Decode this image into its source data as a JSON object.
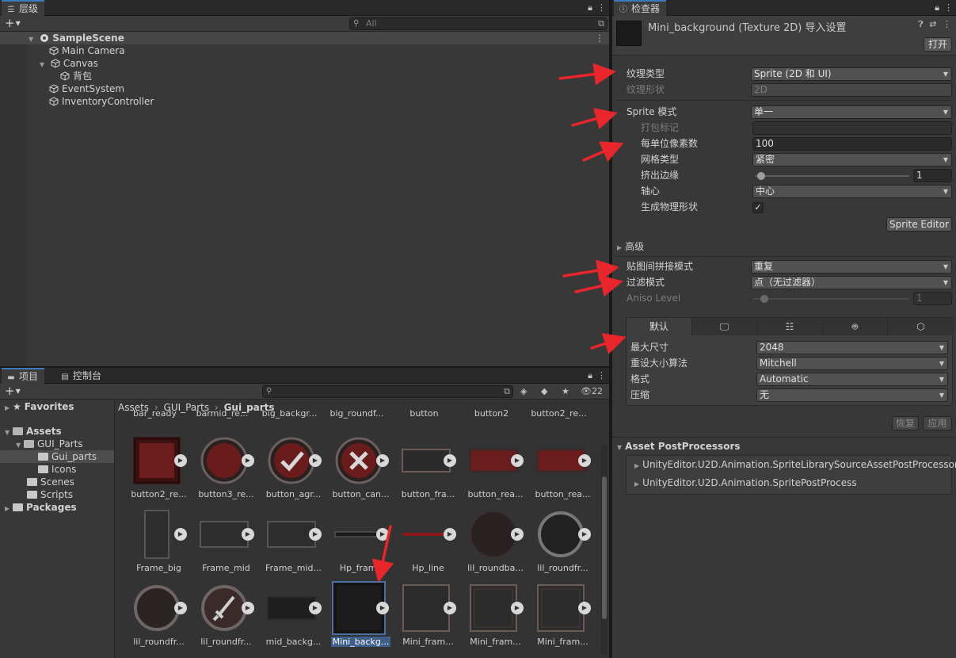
{
  "hierarchy": {
    "tab_label": "层级",
    "search_placeholder": "All",
    "items": [
      {
        "label": "SampleScene"
      },
      {
        "label": "Main Camera"
      },
      {
        "label": "Canvas"
      },
      {
        "label": "背包"
      },
      {
        "label": "EventSystem"
      },
      {
        "label": "InventoryController"
      }
    ]
  },
  "inspector": {
    "tab_label": "检查器",
    "asset_title": "Mini_background (Texture 2D) 导入设置",
    "open_button": "打开",
    "texture_type_label": "纹理类型",
    "texture_type_value": "Sprite (2D 和 UI)",
    "texture_shape_label": "纹理形状",
    "texture_shape_value": "2D",
    "sprite_mode_label": "Sprite 模式",
    "sprite_mode_value": "单一",
    "packing_tag_label": "打包标记",
    "ppu_label": "每单位像素数",
    "ppu_value": "100",
    "mesh_type_label": "网格类型",
    "mesh_type_value": "紧密",
    "extrude_label": "挤出边缘",
    "extrude_value": "1",
    "pivot_label": "轴心",
    "pivot_value": "中心",
    "physics_shape_label": "生成物理形状",
    "physics_shape_check": "✓",
    "sprite_editor_button": "Sprite Editor",
    "advanced_label": "高级",
    "wrap_mode_label": "贴图间拼接模式",
    "wrap_mode_value": "重复",
    "filter_mode_label": "过滤模式",
    "filter_mode_value": "点（无过滤器）",
    "aniso_label": "Aniso Level",
    "aniso_value": "1",
    "platform_default_tab": "默认",
    "max_size_label": "最大尺寸",
    "max_size_value": "2048",
    "resize_label": "重设大小算法",
    "resize_value": "Mitchell",
    "format_label": "格式",
    "format_value": "Automatic",
    "compression_label": "压缩",
    "compression_value": "无",
    "revert_button": "恢复",
    "apply_button": "应用",
    "postprocessors_label": "Asset PostProcessors",
    "postprocessors": [
      "UnityEditor.U2D.Animation.SpriteLibrarySourceAssetPostProcessor",
      "UnityEditor.U2D.Animation.SpritePostProcess"
    ]
  },
  "project": {
    "tab_project": "项目",
    "tab_console": "控制台",
    "hidden_count": "22",
    "breadcrumb": [
      "Assets",
      "GUI_Parts",
      "Gui_parts"
    ],
    "tree": {
      "favorites": "Favorites",
      "assets": "Assets",
      "gui_parts": "GUI_Parts",
      "gui_parts_sub": "Gui_parts",
      "icons": "Icons",
      "scenes": "Scenes",
      "scripts": "Scripts",
      "packages": "Packages"
    },
    "top_row_names": [
      "bar_ready",
      "barmid_re...",
      "big_backgr...",
      "big_roundf...",
      "button",
      "button2",
      "button2_re..."
    ],
    "assets": [
      "button2_re...",
      "button3_re...",
      "button_agr...",
      "button_can...",
      "button_fra...",
      "button_rea...",
      "button_rea...",
      "Frame_big",
      "Frame_mid",
      "Frame_mid...",
      "Hp_frame",
      "Hp_line",
      "lil_roundba...",
      "lil_roundfr...",
      "lil_roundfr...",
      "lil_roundfr...",
      "mid_backg...",
      "Mini_backg...",
      "Mini_fram...",
      "Mini_fram...",
      "Mini_fram..."
    ]
  },
  "colors": {
    "annotation_arrow": "#e8262b",
    "selection": "#3e5f8a",
    "active_tab": "#3a79bb"
  }
}
